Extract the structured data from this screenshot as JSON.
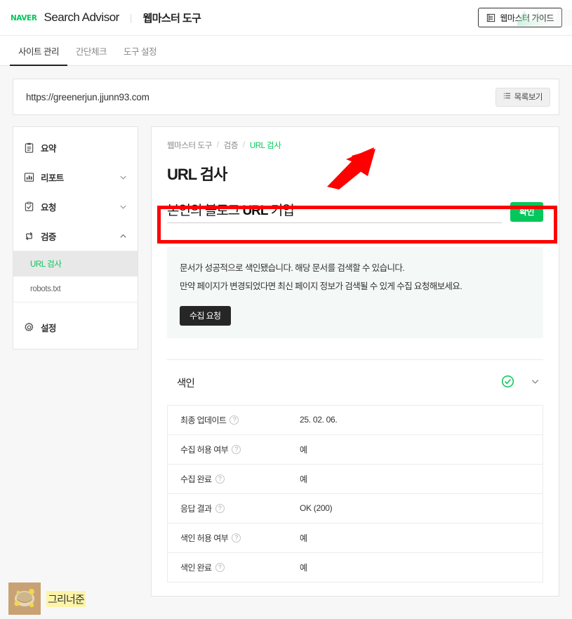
{
  "header": {
    "logo_text": "NAVER",
    "brand": "Search Advisor",
    "separator": "|",
    "sub_brand": "웹마스터 도구",
    "guide_button": "웹마스터 가이드",
    "guide_icon": "book-icon",
    "decoration_icon": "green-wave-graphic"
  },
  "tabs": [
    {
      "label": "사이트 관리",
      "active": true
    },
    {
      "label": "간단체크",
      "active": false
    },
    {
      "label": "도구 설정",
      "active": false
    }
  ],
  "urlbar": {
    "url": "https://greenerjun.jjunn93.com",
    "list_button": "목록보기",
    "list_icon": "list-icon"
  },
  "sidebar": {
    "items": [
      {
        "label": "요약",
        "icon": "clipboard-icon",
        "chevron": "none"
      },
      {
        "label": "리포트",
        "icon": "bar-chart-icon",
        "chevron": "down"
      },
      {
        "label": "요청",
        "icon": "clipboard-check-icon",
        "chevron": "down"
      },
      {
        "label": "검증",
        "icon": "sync-arrows-icon",
        "chevron": "up"
      },
      {
        "label": "설정",
        "icon": "gear-icon",
        "chevron": "none"
      }
    ],
    "submenu": [
      {
        "label": "URL 검사",
        "active": true
      },
      {
        "label": "robots.txt",
        "active": false
      }
    ]
  },
  "breadcrumb": {
    "items": [
      "웹마스터 도구",
      "검증",
      "URL 검사"
    ],
    "separator": "/"
  },
  "main": {
    "page_title": "URL 검사",
    "search": {
      "value_prefix": "본인의 블로그 ",
      "value_bold": "URL",
      "value_suffix": " 기입",
      "confirm_label": "확인"
    },
    "notice": {
      "line1": "문서가 성공적으로 색인됐습니다. 해당 문서를 검색할 수 있습니다.",
      "line2": "만약 페이지가 변경되었다면 최신 페이지 정보가 검색될 수 있게 수집 요청해보세요.",
      "button_label": "수집 요청"
    },
    "section": {
      "title": "색인",
      "status_icon": "check-circle-icon",
      "toggle_icon": "chevron-down-icon"
    },
    "table": {
      "rows": [
        {
          "label": "최종 업데이트",
          "value": "25. 02. 06.",
          "help_icon": "help-icon"
        },
        {
          "label": "수집 허용 여부",
          "value": "예",
          "help_icon": "help-icon"
        },
        {
          "label": "수집 완료",
          "value": "예",
          "help_icon": "help-icon"
        },
        {
          "label": "응답 결과",
          "value": "OK (200)",
          "help_icon": "help-icon"
        },
        {
          "label": "색인 허용 여부",
          "value": "예",
          "help_icon": "help-icon"
        },
        {
          "label": "색인 완료",
          "value": "예",
          "help_icon": "help-icon"
        }
      ]
    }
  },
  "annotations": {
    "rectangle_color": "#ff0000",
    "arrow_color": "#ff0000",
    "arrow_target": "최종 업데이트 값"
  },
  "overlay": {
    "avatar_icon": "blog-avatar",
    "name": "그리너준",
    "highlight_color": "#fdf4a8"
  },
  "colors": {
    "naver_green": "#03c75a",
    "page_bg": "#f7f7f7",
    "notice_bg": "#f4f8f6",
    "dark_button": "#262626"
  }
}
